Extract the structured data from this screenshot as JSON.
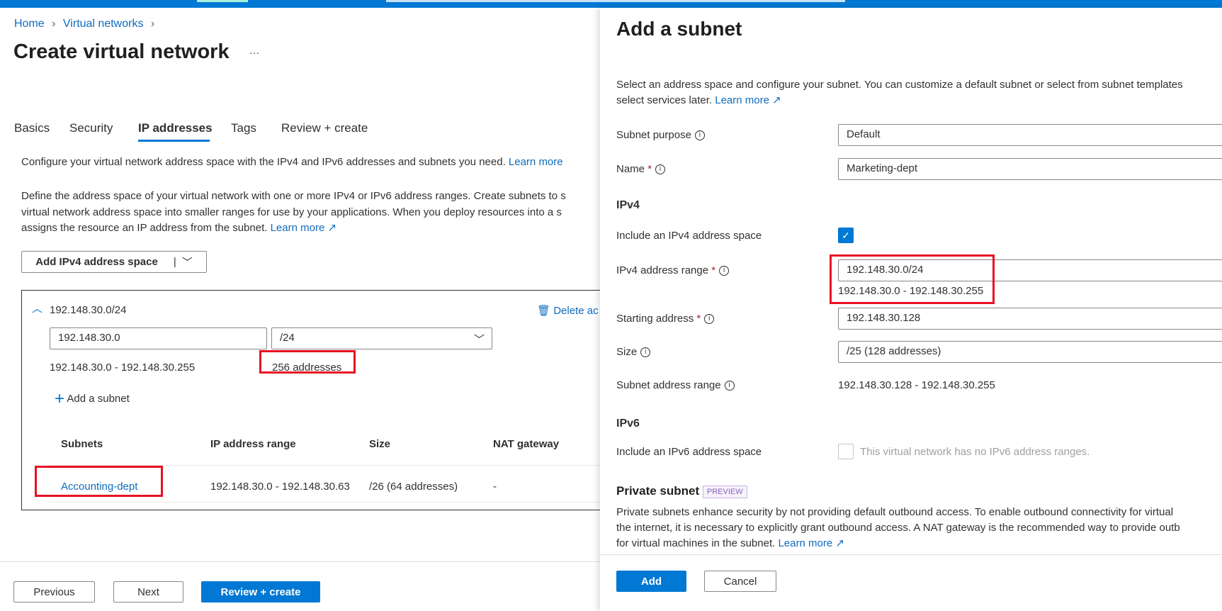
{
  "breadcrumb": [
    "Home",
    "Virtual networks"
  ],
  "page": {
    "title": "Create virtual network",
    "more": "···"
  },
  "tabs": [
    "Basics",
    "Security",
    "IP addresses",
    "Tags",
    "Review + create"
  ],
  "active_tab": "IP addresses",
  "intro": {
    "text": "Configure your virtual network address space with the IPv4 and IPv6 addresses and subnets you need.",
    "link": "Learn more"
  },
  "define": {
    "lines": [
      "Define the address space of your virtual network with one or more IPv4 or IPv6 address ranges. Create subnets to s",
      "virtual network address space into smaller ranges for use by your applications. When you deploy resources into a s",
      "assigns the resource an IP address from the subnet."
    ],
    "link": "Learn more"
  },
  "add_space_button": "Add IPv4 address space",
  "address_space": {
    "title": "192.148.30.0/24",
    "delete": "Delete ac",
    "address": "192.148.30.0",
    "prefix": "/24",
    "range": "192.148.30.0 - 192.148.30.255",
    "count": "256 addresses",
    "add_subnet": "Add a subnet"
  },
  "subnets_table": {
    "headers": [
      "Subnets",
      "IP address range",
      "Size",
      "NAT gateway"
    ],
    "rows": [
      {
        "name": "Accounting-dept",
        "range": "192.148.30.0 - 192.148.30.63",
        "size": "/26 (64 addresses)",
        "nat": "-"
      }
    ]
  },
  "footer": {
    "previous": "Previous",
    "next": "Next",
    "review": "Review + create"
  },
  "panel": {
    "title": "Add a subnet",
    "desc": [
      "Select an address space and configure your subnet. You can customize a default subnet or select from subnet templates",
      "select services later."
    ],
    "desc_link": "Learn more",
    "subnet_purpose": {
      "label": "Subnet purpose",
      "value": "Default"
    },
    "name": {
      "label": "Name",
      "value": "Marketing-dept"
    },
    "ipv4_heading": "IPv4",
    "include_ipv4": {
      "label": "Include an IPv4 address space",
      "checked": true
    },
    "ipv4_range": {
      "label": "IPv4 address range",
      "value": "192.148.30.0/24",
      "range": "192.148.30.0 - 192.148.30.255"
    },
    "starting_address": {
      "label": "Starting address",
      "value": "192.148.30.128"
    },
    "size": {
      "label": "Size",
      "value": "/25 (128 addresses)"
    },
    "subnet_range": {
      "label": "Subnet address range",
      "value": "192.148.30.128 - 192.148.30.255"
    },
    "ipv6_heading": "IPv6",
    "include_ipv6": {
      "label": "Include an IPv6 address space",
      "checked": false,
      "note": "This virtual network has no IPv6 address ranges."
    },
    "private": {
      "heading": "Private subnet",
      "badge": "PREVIEW",
      "lines": [
        "Private subnets enhance security by not providing default outbound access. To enable outbound connectivity for virtual",
        "the internet, it is necessary to explicitly grant outbound access. A NAT gateway is the recommended way to provide outb",
        "for virtual machines in the subnet."
      ],
      "link": "Learn more"
    },
    "add": "Add",
    "cancel": "Cancel"
  },
  "colors": {
    "accent": "#0078d4",
    "highlight": "#e81123",
    "preview": "#8764b8"
  }
}
